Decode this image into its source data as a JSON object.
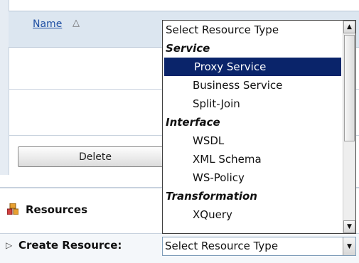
{
  "table": {
    "name_header": "Name",
    "sort_icon": "sort-ascending-icon",
    "delete_label": "Delete"
  },
  "resources": {
    "label": "Resources",
    "icon": "resources-icon",
    "create_label": "Create Resource:",
    "select_value": "Select Resource Type"
  },
  "dropdown": {
    "header": "Select Resource Type",
    "items": [
      {
        "label": "Service",
        "kind": "group"
      },
      {
        "label": "Proxy Service",
        "kind": "option",
        "selected": true
      },
      {
        "label": "Business Service",
        "kind": "option"
      },
      {
        "label": "Split-Join",
        "kind": "option"
      },
      {
        "label": "Interface",
        "kind": "group"
      },
      {
        "label": "WSDL",
        "kind": "option"
      },
      {
        "label": "XML Schema",
        "kind": "option"
      },
      {
        "label": "WS-Policy",
        "kind": "option"
      },
      {
        "label": "Transformation",
        "kind": "group"
      },
      {
        "label": "XQuery",
        "kind": "option"
      }
    ]
  },
  "colors": {
    "selected_bg": "#0a246a",
    "link": "#1f4fa3"
  }
}
